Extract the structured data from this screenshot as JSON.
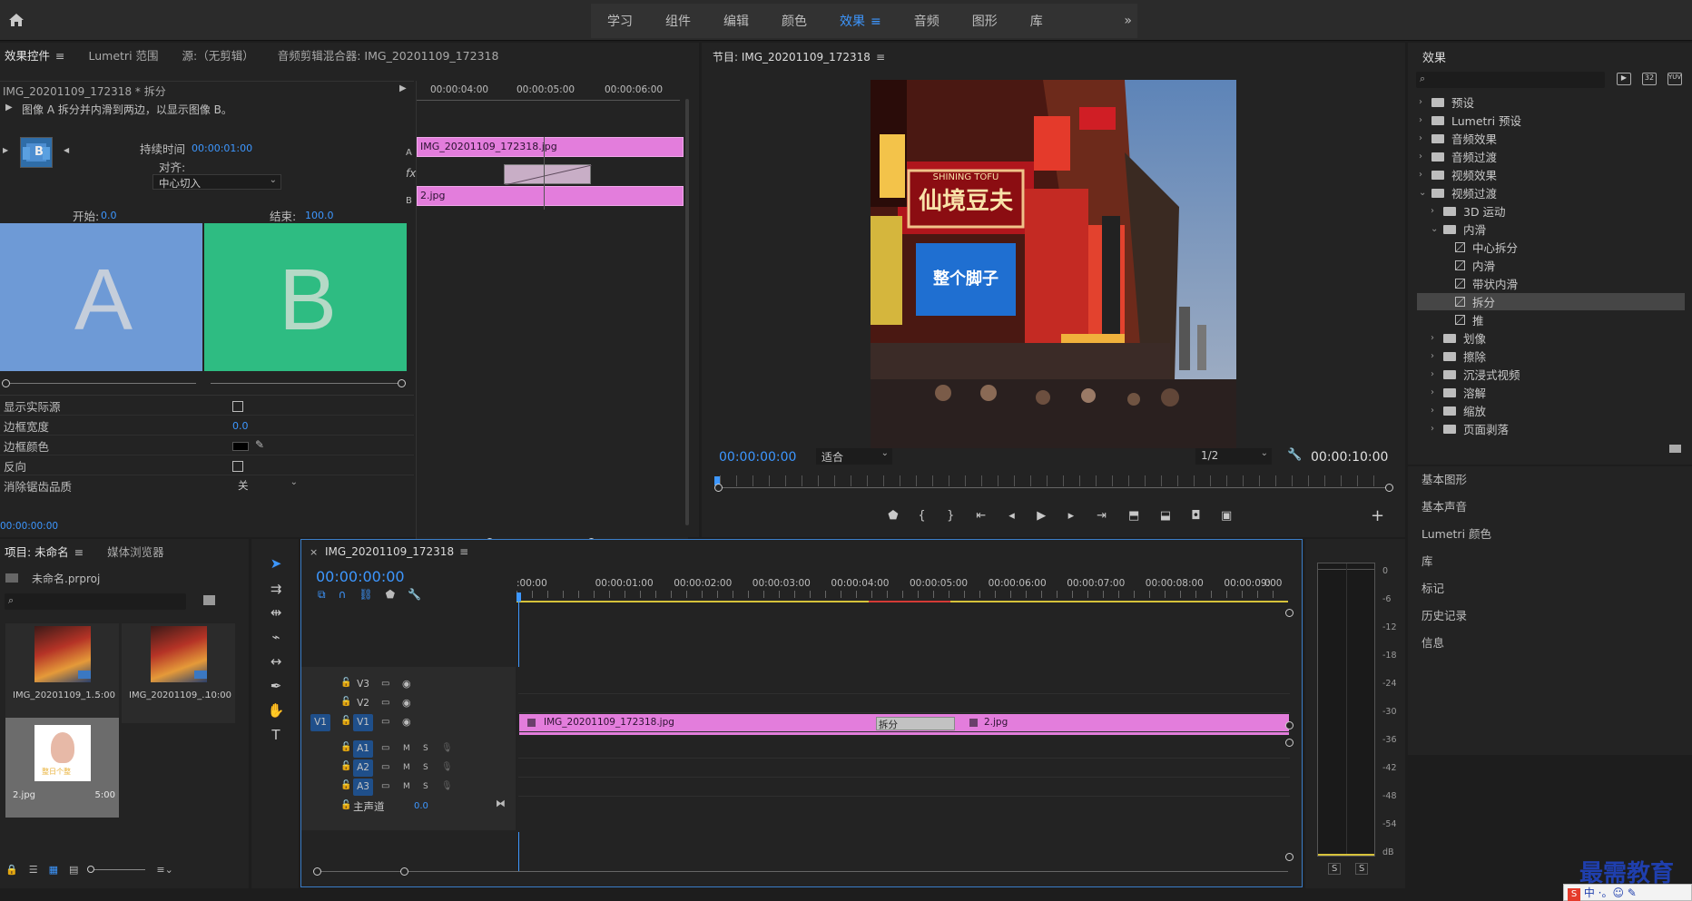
{
  "workspaces": [
    "学习",
    "组件",
    "编辑",
    "颜色",
    "效果",
    "音频",
    "图形",
    "库"
  ],
  "workspaces_active": "效果",
  "workspaces_more": "»",
  "effect_controls": {
    "tabs": [
      "效果控件",
      "Lumetri 范围",
      "源:（无剪辑）",
      "音频剪辑混合器: IMG_20201109_172318"
    ],
    "clip_title": "IMG_20201109_172318 * 拆分",
    "description": "图像 A 拆分并内滑到两边，以显示图像 B。",
    "duration_label": "持续时间",
    "duration_value": "00:00:01:00",
    "align_label": "对齐:",
    "align_value": "中心切入",
    "start_label": "开始:",
    "start_value": "0.0",
    "end_label": "结束:",
    "end_value": "100.0",
    "preview_a": "A",
    "preview_b": "B",
    "props": {
      "show_source": "显示实际源",
      "border_width": "边框宽度",
      "border_width_value": "0.0",
      "border_color": "边框颜色",
      "reverse": "反向",
      "antialias": "消除锯齿品质",
      "antialias_value": "关"
    },
    "timecode": "00:00:00:00",
    "mini_timeline": {
      "ticks": [
        "00:00:04:00",
        "00:00:05:00",
        "00:00:06:00"
      ],
      "track_a_label": "A",
      "track_b_label": "B",
      "fx_label": "fx",
      "clip_a": "IMG_20201109_172318.jpg",
      "clip_b": "2.jpg"
    }
  },
  "program_monitor": {
    "title": "节目: IMG_20201109_172318",
    "timecode_in": "00:00:00:00",
    "fit": "适合",
    "resolution": "1/2",
    "timecode_out": "00:00:10:00",
    "image_signs": [
      "仙境豆夫",
      "SHINING TOFU",
      "整个脚子"
    ]
  },
  "effects_panel": {
    "title": "效果",
    "tree": [
      {
        "label": "预设",
        "level": 0,
        "kind": "folder",
        "expanded": false
      },
      {
        "label": "Lumetri 预设",
        "level": 0,
        "kind": "folder",
        "expanded": false
      },
      {
        "label": "音频效果",
        "level": 0,
        "kind": "folder",
        "expanded": false
      },
      {
        "label": "音频过渡",
        "level": 0,
        "kind": "folder",
        "expanded": false
      },
      {
        "label": "视频效果",
        "level": 0,
        "kind": "folder",
        "expanded": false
      },
      {
        "label": "视频过渡",
        "level": 0,
        "kind": "folder",
        "expanded": true
      },
      {
        "label": "3D 运动",
        "level": 1,
        "kind": "folder",
        "expanded": false
      },
      {
        "label": "内滑",
        "level": 1,
        "kind": "folder",
        "expanded": true
      },
      {
        "label": "中心拆分",
        "level": 2,
        "kind": "effect"
      },
      {
        "label": "内滑",
        "level": 2,
        "kind": "effect"
      },
      {
        "label": "带状内滑",
        "level": 2,
        "kind": "effect"
      },
      {
        "label": "拆分",
        "level": 2,
        "kind": "effect",
        "selected": true
      },
      {
        "label": "推",
        "level": 2,
        "kind": "effect"
      },
      {
        "label": "划像",
        "level": 1,
        "kind": "folder",
        "expanded": false
      },
      {
        "label": "擦除",
        "level": 1,
        "kind": "folder",
        "expanded": false
      },
      {
        "label": "沉浸式视频",
        "level": 1,
        "kind": "folder",
        "expanded": false
      },
      {
        "label": "溶解",
        "level": 1,
        "kind": "folder",
        "expanded": false
      },
      {
        "label": "缩放",
        "level": 1,
        "kind": "folder",
        "expanded": false
      },
      {
        "label": "页面剥落",
        "level": 1,
        "kind": "folder",
        "expanded": false
      }
    ],
    "side_panels": [
      "基本图形",
      "基本声音",
      "Lumetri 颜色",
      "库",
      "标记",
      "历史记录",
      "信息"
    ]
  },
  "project_panel": {
    "tabs": [
      "项目: 未命名",
      "媒体浏览器"
    ],
    "project_file": "未命名.prproj",
    "items": [
      {
        "name": "IMG_20201109_1...",
        "duration": "5:00"
      },
      {
        "name": "IMG_20201109_...",
        "duration": "10:00"
      },
      {
        "name": "2.jpg",
        "duration": "5:00"
      }
    ],
    "thumb_caption": "整日个整"
  },
  "timeline": {
    "sequence_tab": "IMG_20201109_172318",
    "close": "×",
    "timecode": "00:00:00:00",
    "ruler": [
      ":00:00",
      "00:00:01:00",
      "00:00:02:00",
      "00:00:03:00",
      "00:00:04:00",
      "00:00:05:00",
      "00:00:06:00",
      "00:00:07:00",
      "00:00:08:00",
      "00:00:09:00",
      "0"
    ],
    "video_tracks": [
      "V3",
      "V2",
      "V1"
    ],
    "source_patch": "V1",
    "audio_tracks": [
      "A1",
      "A2",
      "A3"
    ],
    "mute": "M",
    "solo": "S",
    "master_label": "主声道",
    "master_value": "0.0",
    "clip1": "IMG_20201109_172318.jpg",
    "transition": "拆分",
    "clip2": "2.jpg"
  },
  "audio_meter": {
    "scale": [
      "0",
      "-6",
      "-12",
      "-18",
      "-24",
      "-30",
      "-36",
      "-42",
      "-48",
      "-54",
      "dB"
    ],
    "solo_buttons": [
      "S",
      "S"
    ]
  },
  "watermark": "最需教育",
  "ime_bar": "中 ·。☺ ✎",
  "colors": {
    "accent": "#3d97ff",
    "clip_pink": "#e37ddc",
    "panel_bg": "#232323",
    "a_blue": "#6e9ad6",
    "b_green": "#2ebc82"
  }
}
